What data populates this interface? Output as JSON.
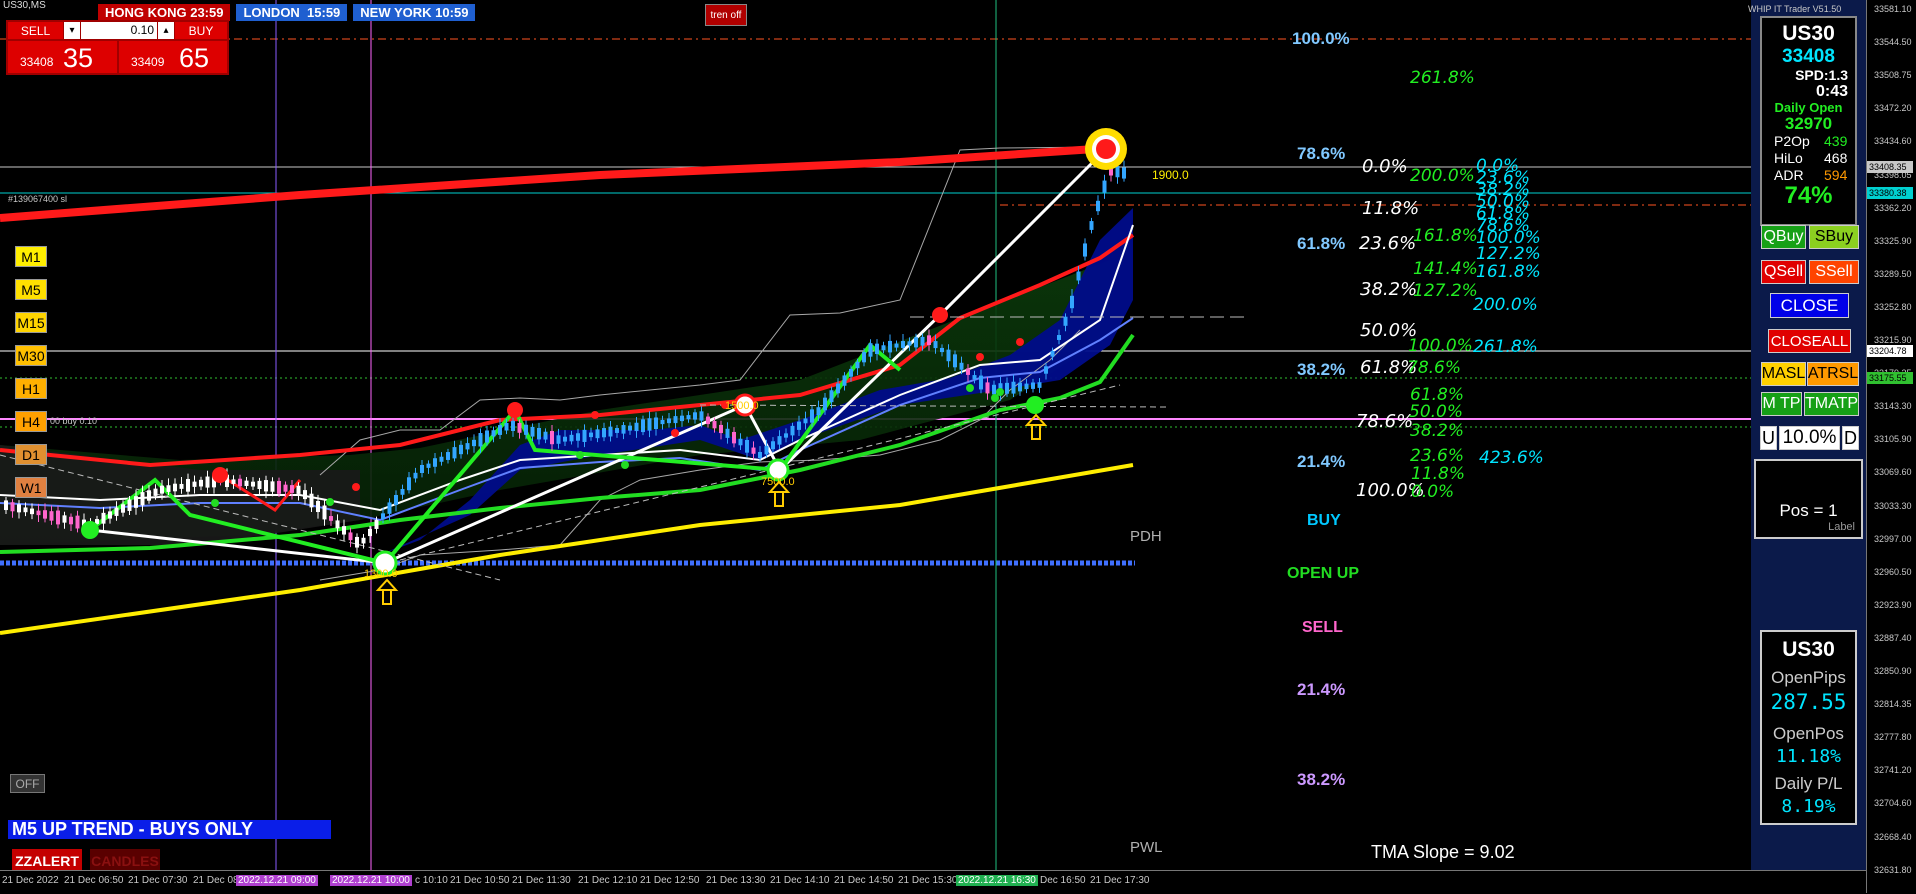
{
  "window": {
    "title": "US30,MS",
    "indicator_tag": "WHIP IT Trader V51.50"
  },
  "sessions": [
    {
      "label": "HONG KONG 23:59",
      "bg": "#c00000"
    },
    {
      "label": "LONDON  15:59",
      "bg": "#1f5fd0"
    },
    {
      "label": "NEW YORK 10:59",
      "bg": "#1f5fd0"
    }
  ],
  "trade_button": "tren off",
  "one_click": {
    "sell_label": "SELL",
    "buy_label": "BUY",
    "lot": "0.10",
    "sell_price_small": "33408",
    "sell_price_big": "35",
    "buy_price_small": "33409",
    "buy_price_big": "65"
  },
  "timeframes": [
    "M1",
    "M5",
    "M15",
    "M30",
    "H1",
    "H4",
    "D1",
    "W1"
  ],
  "off_button": "OFF",
  "trend_banner": "M5 UP TREND - BUYS ONLY",
  "alerts": {
    "zz": "ZZALERT",
    "candles": "CANDLES"
  },
  "chart_labels": {
    "order_tag": "#139067400 sl",
    "buy_line": "00 buy 0.10",
    "level_1900": "1900.0",
    "pdh": "PDH",
    "pwl": "PWL",
    "buy": "BUY",
    "open_up": "OPEN UP",
    "sell": "SELL",
    "tma_slope": "TMA Slope = 9.02",
    "zig_1": "1500.0",
    "zig_2": "7500.0",
    "zig_3": "1300.0"
  },
  "fib_left": [
    "100.0%",
    "78.6%",
    "61.8%",
    "38.2%",
    "21.4%",
    "21.4%",
    "38.2%"
  ],
  "fib_white": [
    "0.0%",
    "11.8%",
    "23.6%",
    "38.2%",
    "50.0%",
    "61.8%",
    "78.6%",
    "100.0%"
  ],
  "fib_green_a": [
    "261.8%",
    "200.0%",
    "161.8%",
    "141.4%",
    "127.2%",
    "100.0%",
    "78.6%",
    "61.8%",
    "50.0%",
    "38.2%",
    "23.6%",
    "11.8%",
    "0.0%"
  ],
  "fib_cyan": [
    "0.0%",
    "23.6%",
    "38.2%",
    "50.0%",
    "61.8%",
    "78.6%",
    "100.0%",
    "127.2%",
    "161.8%",
    "200.0%",
    "261.8%",
    "423.6%"
  ],
  "info_panel": {
    "symbol": "US30",
    "price": "33408",
    "spread": "SPD:1.3",
    "timer": "0:43",
    "daily_open_label": "Daily Open",
    "daily_open": "32970",
    "rows": [
      {
        "k": "P2Op",
        "v": "439"
      },
      {
        "k": "HiLo",
        "v": "468"
      },
      {
        "k": "ADR",
        "v": "594"
      }
    ],
    "pct": "74%"
  },
  "trade_buttons": {
    "qbuy": "QBuy",
    "sbuy": "SBuy",
    "qsell": "QSell",
    "ssell": "SSell",
    "close": "CLOSE",
    "closeall": "CLOSEALL",
    "masl": "MASL",
    "atrsl": "ATRSL",
    "mtp": "M TP",
    "tmatp": "TMATP",
    "u": "U",
    "risk": "10.0%",
    "d": "D"
  },
  "pos_panel": {
    "text": "Pos = 1",
    "sub": "Label"
  },
  "pips_panel": {
    "symbol": "US30",
    "open_pips_label": "OpenPips",
    "open_pips": "287.55",
    "open_pos_label": "OpenPos",
    "open_pos": "11.18%",
    "daily_pl_label": "Daily P/L",
    "daily_pl": "8.19%"
  },
  "price_axis": [
    "33581.10",
    "33544.50",
    "33508.75",
    "33472.20",
    "33434.60",
    "33398.05",
    "33362.20",
    "33325.90",
    "33289.50",
    "33252.80",
    "33215.90",
    "33179.35",
    "33143.30",
    "33105.90",
    "33069.60",
    "33033.30",
    "32997.00",
    "32960.50",
    "32923.90",
    "32887.40",
    "32850.90",
    "32814.35",
    "32777.80",
    "32741.20",
    "32704.60",
    "32668.40",
    "32631.80"
  ],
  "price_tags": [
    {
      "label": "33408.35",
      "bg": "#c8c8c8",
      "fg": "#000"
    },
    {
      "label": "33380.38",
      "bg": "#00d0d0",
      "fg": "#000"
    },
    {
      "label": "33204.78",
      "bg": "#ffffff",
      "fg": "#000"
    },
    {
      "label": "33175.55",
      "bg": "#30c030",
      "fg": "#000"
    }
  ],
  "time_axis": [
    "21 Dec 2022",
    "21 Dec 06:50",
    "21 Dec 07:30",
    "21 Dec 08",
    "2022.12.21 09:00",
    "2022.12.21 10:00",
    "c 10:10",
    "21 Dec 10:50",
    "21 Dec 11:30",
    "21 Dec 12:10",
    "21 Dec 12:50",
    "21 Dec 13:30",
    "21 Dec 14:10",
    "21 Dec 14:50",
    "21 Dec 15:30",
    "2022.12.21 16:30",
    "Dec 16:50",
    "21 Dec 17:30"
  ],
  "colors": {
    "up": "#33a6ff",
    "down": "#ff66cc",
    "red": "#ff1a1a",
    "green": "#22dd22",
    "yellow": "#ffee00",
    "cyan": "#00e5ff",
    "navy": "#000c8a"
  }
}
